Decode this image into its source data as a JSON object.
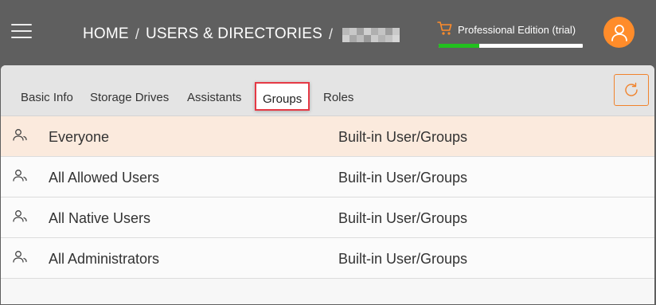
{
  "header": {
    "breadcrumb": [
      {
        "label": "HOME"
      },
      {
        "label": "USERS & DIRECTORIES"
      }
    ],
    "separator": "/",
    "redacted_name_colors": [
      "#b9b9b9",
      "#c8c8c8",
      "#a2a2a2",
      "#d0d0d0",
      "#b0b0b0",
      "#c4c4c4",
      "#9e9e9e",
      "#c9c9c9",
      "#cfcfcf",
      "#a8a8a8",
      "#bdbdbd",
      "#9a9a9a",
      "#cbcbcb",
      "#b4b4b4",
      "#c2c2c2",
      "#d6d6d6"
    ],
    "edition": {
      "icon": "cart-icon",
      "label": "Professional Edition (trial)",
      "trial_progress_percent": 28,
      "progress_color": "#22c01e"
    },
    "avatar_icon": "user-icon",
    "accent_color": "#ff8c2a"
  },
  "tabs": [
    {
      "label": "Basic Info",
      "active": false
    },
    {
      "label": "Storage Drives",
      "active": false
    },
    {
      "label": "Assistants",
      "active": false
    },
    {
      "label": "Groups",
      "active": true
    },
    {
      "label": "Roles",
      "active": false
    }
  ],
  "refresh_icon": "refresh-icon",
  "groups": [
    {
      "name": "Everyone",
      "type": "Built-in User/Groups",
      "highlighted": true,
      "icon": "group-icon"
    },
    {
      "name": "All Allowed Users",
      "type": "Built-in User/Groups",
      "highlighted": false,
      "icon": "group-icon"
    },
    {
      "name": "All Native Users",
      "type": "Built-in User/Groups",
      "highlighted": false,
      "icon": "group-icon"
    },
    {
      "name": "All Administrators",
      "type": "Built-in User/Groups",
      "highlighted": false,
      "icon": "group-icon"
    }
  ]
}
